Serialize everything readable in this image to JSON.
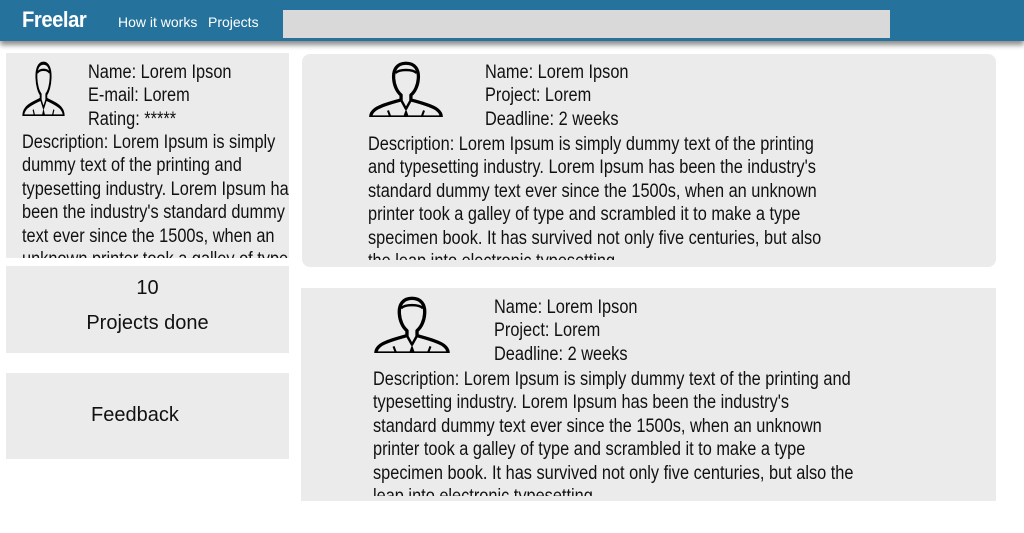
{
  "navbar": {
    "brand": "Freelar",
    "links": [
      "How it works",
      "Projects"
    ],
    "search": {
      "value": "",
      "placeholder": ""
    },
    "color": "#25739c"
  },
  "profile": {
    "avatar_icon": "user-avatar-icon",
    "name_line": "Name: Lorem Ipson",
    "email_line": "E-mail: Lorem",
    "rating_line": "Rating: *****",
    "description": "Description:  Lorem Ipsum is simply dummy text of the printing and typesetting industry. Lorem Ipsum has been the industry's standard dummy text ever since the 1500s, when an unknown printer took a galley of type and scrambled it to make a type specimen book."
  },
  "stats": {
    "count": "10",
    "label": "Projects done"
  },
  "feedback": {
    "label": "Feedback"
  },
  "projects": [
    {
      "avatar_icon": "user-avatar-icon",
      "name_line": "Name: Lorem Ipson",
      "project_line": "Project: Lorem",
      "deadline_line": "Deadline: 2 weeks",
      "description": "Description:  Lorem Ipsum is simply dummy text of the printing and typesetting industry. Lorem Ipsum has been the industry's standard dummy text ever since the 1500s, when an unknown printer took a galley of type and scrambled it to make a type specimen book. It has survived not only five centuries, but also the leap into electronic typesetting"
    },
    {
      "avatar_icon": "user-avatar-icon",
      "name_line": "Name: Lorem Ipson",
      "project_line": "Project: Lorem",
      "deadline_line": "Deadline: 2 weeks",
      "description": "Description:  Lorem Ipsum is simply dummy text of the printing and typesetting industry. Lorem Ipsum has been the industry's standard dummy text ever since the 1500s, when an unknown printer took a galley of type and scrambled it to make a type specimen book. It has survived not only five centuries, but also the leap into electronic typesetting"
    }
  ]
}
